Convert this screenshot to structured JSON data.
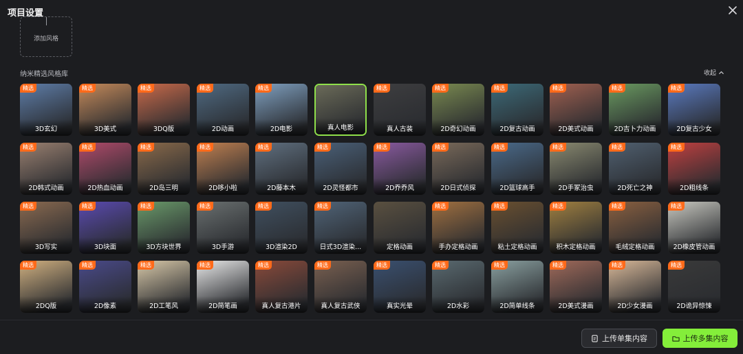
{
  "header": {
    "title": "项目设置"
  },
  "add_style": {
    "label": "添加风格"
  },
  "library": {
    "title": "纳米精选风格库",
    "collapse_label": "收起"
  },
  "badge_label": "精选",
  "selected_index": 5,
  "colors": {
    "accent": "#84ee3a",
    "badge": "#ff6a1a",
    "background": "#1c1d20"
  },
  "styles": [
    {
      "name": "3D玄幻",
      "featured": true,
      "tone": "#5e7da8"
    },
    {
      "name": "3D美式",
      "featured": true,
      "tone": "#c58a5a"
    },
    {
      "name": "3DQ版",
      "featured": true,
      "tone": "#c96a4a"
    },
    {
      "name": "2D动画",
      "featured": true,
      "tone": "#4f6a82"
    },
    {
      "name": "2D电影",
      "featured": true,
      "tone": "#7fa0c0"
    },
    {
      "name": "真人电影",
      "featured": false,
      "tone": "#6a6a58"
    },
    {
      "name": "真人古装",
      "featured": true,
      "tone": "#3e3e40"
    },
    {
      "name": "2D奇幻动画",
      "featured": true,
      "tone": "#7a8a50"
    },
    {
      "name": "2D复古动画",
      "featured": true,
      "tone": "#3c6a78"
    },
    {
      "name": "2D美式动画",
      "featured": true,
      "tone": "#a06050"
    },
    {
      "name": "2D吉卜力动画",
      "featured": true,
      "tone": "#6a9a60"
    },
    {
      "name": "2D复古少女",
      "featured": true,
      "tone": "#5a7ac0"
    },
    {
      "name": "2D韩式动画",
      "featured": true,
      "tone": "#9a8070"
    },
    {
      "name": "2D热血动画",
      "featured": true,
      "tone": "#b04a6a"
    },
    {
      "name": "2D岛三明",
      "featured": true,
      "tone": "#8a6a4a"
    },
    {
      "name": "2D哆小啦",
      "featured": true,
      "tone": "#c08050"
    },
    {
      "name": "2D藤本木",
      "featured": true,
      "tone": "#607080"
    },
    {
      "name": "2D灵怪都市",
      "featured": true,
      "tone": "#4a6078"
    },
    {
      "name": "2D乔乔风",
      "featured": true,
      "tone": "#8a5aa0"
    },
    {
      "name": "2D日式侦探",
      "featured": true,
      "tone": "#7a6a5a"
    },
    {
      "name": "2D篮球高手",
      "featured": true,
      "tone": "#4a6a8a"
    },
    {
      "name": "2D手冢治虫",
      "featured": true,
      "tone": "#8a8a70"
    },
    {
      "name": "2D死亡之神",
      "featured": true,
      "tone": "#506070"
    },
    {
      "name": "2D粗线条",
      "featured": true,
      "tone": "#c04040"
    },
    {
      "name": "3D写实",
      "featured": true,
      "tone": "#8a6a50"
    },
    {
      "name": "3D块面",
      "featured": true,
      "tone": "#5a4ab0"
    },
    {
      "name": "3D方块世界",
      "featured": true,
      "tone": "#6a9a6a"
    },
    {
      "name": "3D手游",
      "featured": true,
      "tone": "#6a7070"
    },
    {
      "name": "3D渲染2D",
      "featured": true,
      "tone": "#405060"
    },
    {
      "name": "日式3D渲染...",
      "featured": true,
      "tone": "#506478"
    },
    {
      "name": "定格动画",
      "featured": false,
      "tone": "#5a5040"
    },
    {
      "name": "手办定格动画",
      "featured": true,
      "tone": "#a07040"
    },
    {
      "name": "粘土定格动画",
      "featured": true,
      "tone": "#6a5030"
    },
    {
      "name": "积木定格动画",
      "featured": true,
      "tone": "#a08040"
    },
    {
      "name": "毛绒定格动画",
      "featured": true,
      "tone": "#8a6040"
    },
    {
      "name": "2D橡皮管动画",
      "featured": true,
      "tone": "#c8c8c0"
    },
    {
      "name": "2DQ版",
      "featured": true,
      "tone": "#d0b080"
    },
    {
      "name": "2D像素",
      "featured": true,
      "tone": "#4a4a8a"
    },
    {
      "name": "2D工笔风",
      "featured": true,
      "tone": "#d8c8a8"
    },
    {
      "name": "2D简笔画",
      "featured": true,
      "tone": "#e8e8e8"
    },
    {
      "name": "真人复古港片",
      "featured": true,
      "tone": "#8a4a3a"
    },
    {
      "name": "真人复古武侠",
      "featured": true,
      "tone": "#7a6050"
    },
    {
      "name": "真实光晕",
      "featured": true,
      "tone": "#3a5070"
    },
    {
      "name": "2D水彩",
      "featured": true,
      "tone": "#5a6a70"
    },
    {
      "name": "2D简单线条",
      "featured": true,
      "tone": "#8aa0a0"
    },
    {
      "name": "2D美式漫画",
      "featured": true,
      "tone": "#a06a5a"
    },
    {
      "name": "2D少女漫画",
      "featured": true,
      "tone": "#d8b898"
    },
    {
      "name": "2D诡异惊悚",
      "featured": true,
      "tone": "#3a3a3a"
    }
  ],
  "footer": {
    "upload_single": "上传单集内容",
    "upload_multi": "上传多集内容"
  }
}
